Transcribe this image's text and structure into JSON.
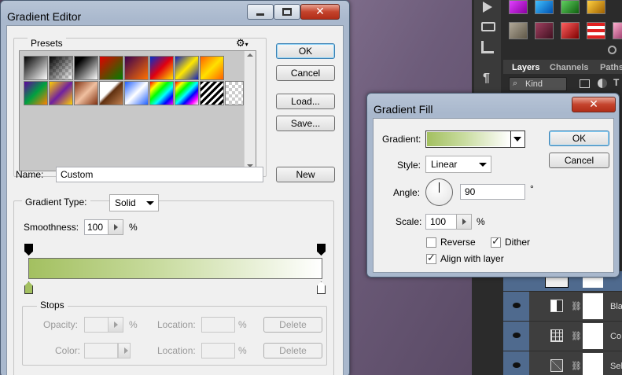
{
  "gradient_editor": {
    "title": "Gradient Editor",
    "presets_label": "Presets",
    "buttons": {
      "ok": "OK",
      "cancel": "Cancel",
      "load": "Load...",
      "save": "Save...",
      "new": "New",
      "delete": "Delete"
    },
    "name_label": "Name:",
    "name_value": "Custom",
    "gradient_type_label": "Gradient Type:",
    "gradient_type_value": "Solid",
    "smoothness_label": "Smoothness:",
    "smoothness_value": "100",
    "percent": "%",
    "stops_label": "Stops",
    "opacity_label": "Opacity:",
    "color_label": "Color:",
    "location_label": "Location:",
    "gradient_start_color": "#a3c060",
    "gradient_end_color": "#ffffff"
  },
  "gradient_fill": {
    "title": "Gradient Fill",
    "gradient_label": "Gradient:",
    "style_label": "Style:",
    "style_value": "Linear",
    "angle_label": "Angle:",
    "angle_value": "90",
    "degree": "°",
    "scale_label": "Scale:",
    "scale_value": "100",
    "percent": "%",
    "reverse_label": "Reverse",
    "reverse_checked": false,
    "dither_label": "Dither",
    "dither_checked": true,
    "align_label": "Align with layer",
    "align_checked": true,
    "ok": "OK",
    "cancel": "Cancel"
  },
  "panels": {
    "tabs": [
      "Layers",
      "Channels",
      "Paths"
    ],
    "kind_label": "Kind",
    "layer_names": [
      "Bla",
      "Co",
      "Sel"
    ]
  }
}
